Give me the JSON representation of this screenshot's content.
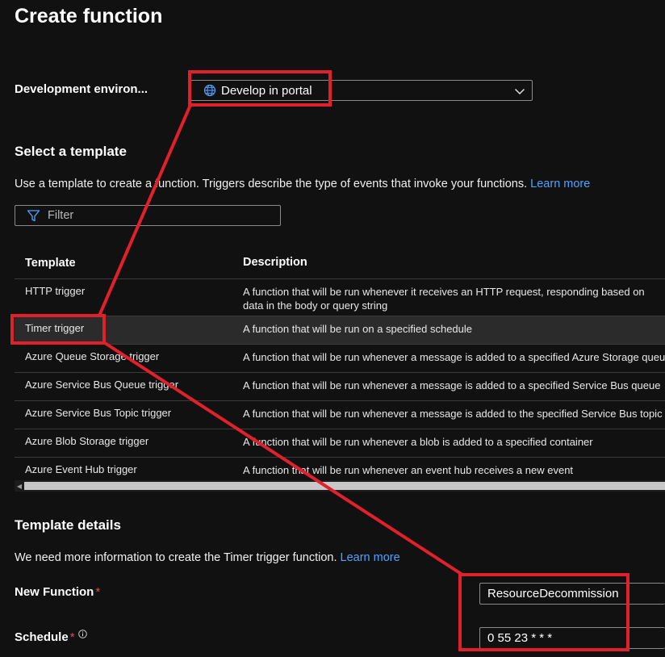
{
  "page": {
    "title": "Create function"
  },
  "dev_env": {
    "label": "Development environ...",
    "value": "Develop in portal",
    "icon": "globe-icon"
  },
  "template_section": {
    "title": "Select a template",
    "description": "Use a template to create a function. Triggers describe the type of events that invoke your functions.",
    "learn_more": "Learn more",
    "filter_placeholder": "Filter"
  },
  "table": {
    "headers": [
      "Template",
      "Description"
    ],
    "rows": [
      {
        "name": "HTTP trigger",
        "description": "A function that will be run whenever it receives an HTTP request, responding based on data in the body or query string",
        "selected": false
      },
      {
        "name": "Timer trigger",
        "description": "A function that will be run on a specified schedule",
        "selected": true
      },
      {
        "name": "Azure Queue Storage trigger",
        "description": "A function that will be run whenever a message is added to a specified Azure Storage queue",
        "selected": false
      },
      {
        "name": "Azure Service Bus Queue trigger",
        "description": "A function that will be run whenever a message is added to a specified Service Bus queue",
        "selected": false
      },
      {
        "name": "Azure Service Bus Topic trigger",
        "description": "A function that will be run whenever a message is added to the specified Service Bus topic",
        "selected": false
      },
      {
        "name": "Azure Blob Storage trigger",
        "description": "A function that will be run whenever a blob is added to a specified container",
        "selected": false
      },
      {
        "name": "Azure Event Hub trigger",
        "description": "A function that will be run whenever an event hub receives a new event",
        "selected": false
      }
    ]
  },
  "details": {
    "title": "Template details",
    "description": "We need more information to create the Timer trigger function.",
    "learn_more": "Learn more",
    "new_function_label": "New Function",
    "new_function_value": "ResourceDecommission",
    "schedule_label": "Schedule",
    "schedule_value": "0 55 23 * * *",
    "required_mark": "*"
  },
  "colors": {
    "accent_link": "#4da3ff",
    "annotation_red": "#e0202a",
    "required": "#e5484d"
  }
}
